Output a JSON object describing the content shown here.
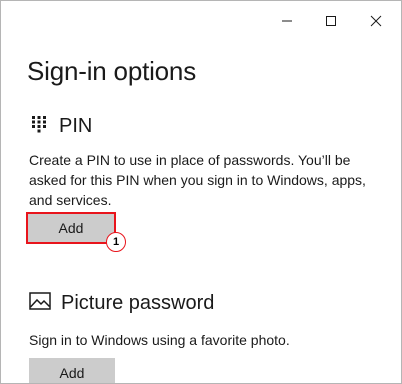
{
  "window": {
    "controls": {
      "minimize_icon": "minimize-icon",
      "maximize_icon": "maximize-icon",
      "close_icon": "close-icon"
    }
  },
  "page": {
    "title": "Sign-in options"
  },
  "pin": {
    "icon": "keypad-icon",
    "heading": "PIN",
    "description": "Create a PIN to use in place of passwords. You’ll be asked for this PIN when you sign in to Windows, apps, and services.",
    "add_label": "Add",
    "callout_number": "1"
  },
  "picture_password": {
    "icon": "picture-icon",
    "heading": "Picture password",
    "description": "Sign in to Windows using a favorite photo.",
    "add_label": "Add"
  },
  "colors": {
    "highlight": "#e8141c",
    "button_bg": "#cccccc",
    "text": "#1a1a1a"
  }
}
